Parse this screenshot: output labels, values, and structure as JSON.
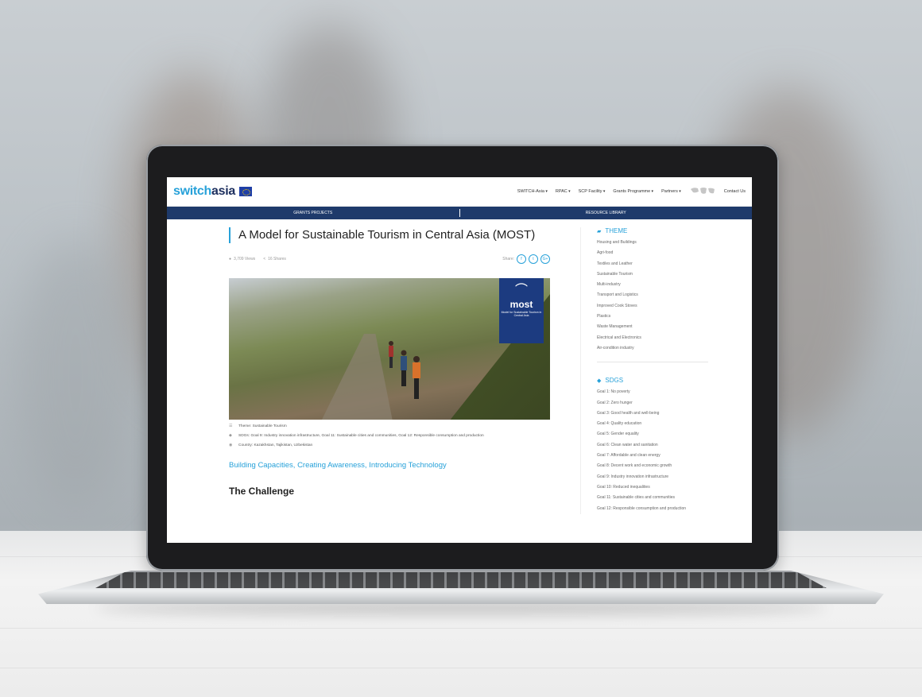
{
  "site": {
    "logo_prefix": "switch",
    "logo_suffix": "asia",
    "nav": [
      "SWITCH-Asia",
      "RPAC",
      "SCP Facility",
      "Grants Programme",
      "Partners",
      "Contact Us"
    ],
    "subnav": [
      "GRANTS PROJECTS",
      "RESOURCE LIBRARY"
    ]
  },
  "article": {
    "title": "A Model for Sustainable Tourism in Central Asia (MOST)",
    "views": "3,709 Views",
    "shares": "16 Shares",
    "share_label": "Share:",
    "share_buttons": [
      "f",
      "t",
      "G+"
    ],
    "image_badge": {
      "word": "most",
      "sub": "Model for Sustainable Tourism in Central Asia"
    },
    "theme": "Theme: Sustainable Tourism",
    "sdgs": "SDGs: Goal 9: Industry innovation infrastructure, Goal 11: Sustainable cities and communities, Goal 12: Responsible consumption and production",
    "countries": "Country: Kazakhstan, Tajikistan, Uzbekistan",
    "subheading": "Building Capacities, Creating Awareness, Introducing Technology",
    "section": "The Challenge"
  },
  "sidebar": {
    "theme_heading": "THEME",
    "themes": [
      "Housing and Buildings",
      "Agri-food",
      "Textiles and Leather",
      "Sustainable Tourism",
      "Multi-industry",
      "Transport and Logistics",
      "Improved Cook Stoves",
      "Plastics",
      "Waste Management",
      "Electrical and Electronics",
      "Air-condition industry"
    ],
    "sdgs_heading": "SDGS",
    "sdgs": [
      "Goal 1: No poverty",
      "Goal 2: Zero hunger",
      "Goal 3: Good health and well-being",
      "Goal 4: Quality education",
      "Goal 5: Gender equality",
      "Goal 6: Clean water and sanitation",
      "Goal 7: Affordable and clean energy",
      "Goal 8: Decent work and economic growth",
      "Goal 9: Industry innovation infrastructure",
      "Goal 10: Reduced inequalities",
      "Goal 11: Sustainable cities and communities",
      "Goal 12: Responsible consumption and production"
    ]
  }
}
